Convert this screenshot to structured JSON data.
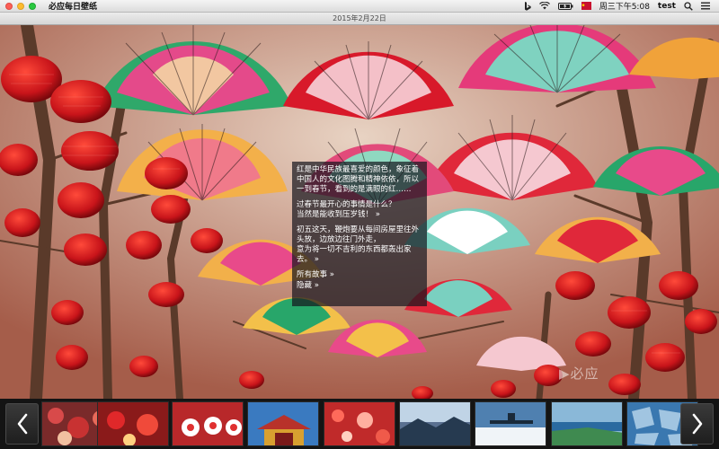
{
  "menubar": {
    "app_name": "必应每日壁纸",
    "clock": "周三下午5:08",
    "user": "test",
    "icons": [
      "bing-icon",
      "wifi-icon",
      "battery-icon",
      "flag-icon",
      "search-icon",
      "list-icon"
    ]
  },
  "window": {
    "title": "2015年2月22日"
  },
  "story": {
    "p1": "红是中华民族最喜爱的颜色，象征着中国人的文化图腾和精神依依，所以一到春节，看到的是满眼的红……",
    "p2a": "过春节最开心的事情是什么？",
    "p2b": "当然是能收到压岁钱！",
    "p3a": "初五这天，鞭炮要从每间房屋里往外头放，边放边往门外走，",
    "p3b": "意为将一切不吉利的东西都轰出家去。",
    "more_glyph": "»",
    "link_all": "所有故事",
    "link_hide": "隐藏"
  },
  "watermark": "必应",
  "filmstrip": {
    "prev_icon": "chevron-left-icon",
    "next_icon": "chevron-right-icon",
    "thumbnails": [
      {
        "name": "thumb-red-ornaments",
        "color": "#b83a3a"
      },
      {
        "name": "thumb-red-lanterns",
        "color": "#c8282a"
      },
      {
        "name": "thumb-lucky-cats",
        "color": "#d04030"
      },
      {
        "name": "thumb-temple-gate",
        "color": "#2f6aa8"
      },
      {
        "name": "thumb-red-flowers",
        "color": "#c02a2a"
      },
      {
        "name": "thumb-misty-forest",
        "color": "#5a6f86"
      },
      {
        "name": "thumb-pier-snow",
        "color": "#4f7fae"
      },
      {
        "name": "thumb-coast-cliff",
        "color": "#3f8a70"
      },
      {
        "name": "thumb-blue-ice",
        "color": "#4a86b8"
      }
    ]
  }
}
